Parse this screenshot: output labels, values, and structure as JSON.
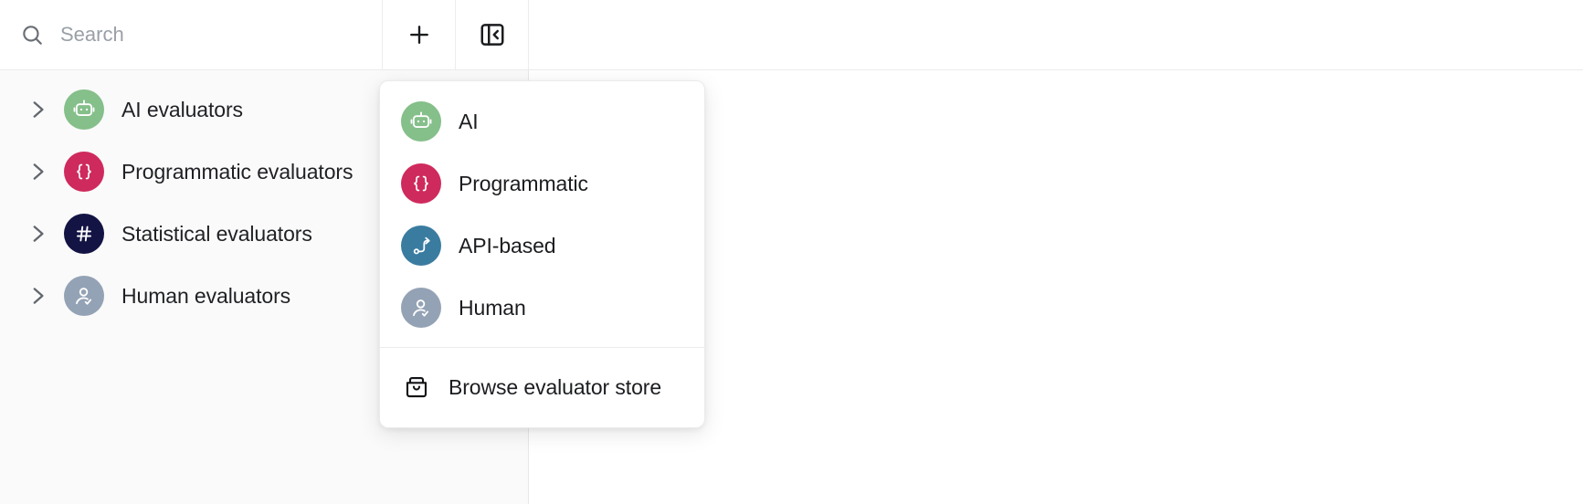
{
  "toolbar": {
    "search": {
      "icon": "search-icon",
      "placeholder": "Search",
      "value": ""
    },
    "add_button": {
      "icon": "plus-icon",
      "label": ""
    },
    "collapse_button": {
      "icon": "collapse-sidebar-icon",
      "label": ""
    }
  },
  "sidebar": {
    "items": [
      {
        "label": "AI evaluators",
        "icon": "robot-icon",
        "color": "#85bf8a",
        "chevron": "chevron-right-icon"
      },
      {
        "label": "Programmatic evaluators",
        "icon": "curly-braces-icon",
        "color": "#cf2a5d",
        "chevron": "chevron-right-icon"
      },
      {
        "label": "Statistical evaluators",
        "icon": "hash-icon",
        "color": "#131444",
        "chevron": "chevron-right-icon"
      },
      {
        "label": "Human evaluators",
        "icon": "person-check-icon",
        "color": "#94a2b5",
        "chevron": "chevron-right-icon"
      }
    ]
  },
  "menu": {
    "items": [
      {
        "label": "AI",
        "icon": "robot-icon",
        "color": "#85bf8a"
      },
      {
        "label": "Programmatic",
        "icon": "curly-braces-icon",
        "color": "#cf2a5d"
      },
      {
        "label": "API-based",
        "icon": "route-icon",
        "color": "#3a7ca0"
      },
      {
        "label": "Human",
        "icon": "person-check-icon",
        "color": "#94a2b5"
      }
    ],
    "footer": {
      "label": "Browse evaluator store",
      "icon": "shopping-bag-icon"
    }
  },
  "colors": {
    "panel_background": "#fafafa",
    "content_background": "#ffffff",
    "border": "#ececec",
    "text_primary": "#1f2125",
    "placeholder": "#9aa0a6"
  }
}
